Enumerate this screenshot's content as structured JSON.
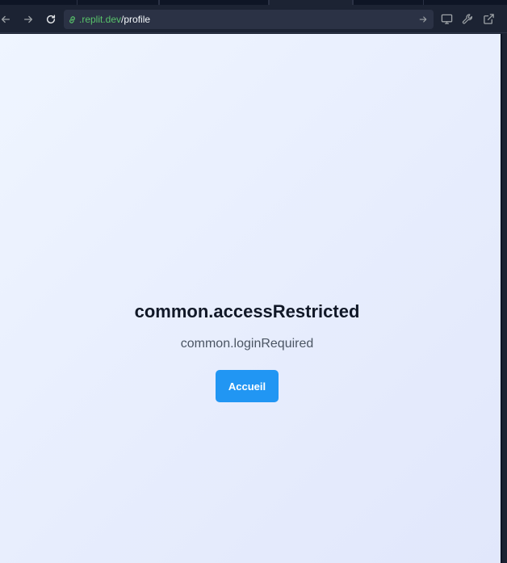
{
  "browser": {
    "url_host": ".replit.dev",
    "url_path": "/profile",
    "nav_icons": [
      "arrow-left-icon",
      "arrow-right-icon",
      "reload-icon"
    ],
    "tool_icons": [
      "monitor-icon",
      "wrench-icon",
      "external-link-icon"
    ]
  },
  "page": {
    "title": "common.accessRestricted",
    "message": "common.loginRequired",
    "home_button_label": "Accueil"
  },
  "colors": {
    "accent_button": "#2196f3",
    "url_host": "#58c26a",
    "toolbar_bg": "#1c2333"
  }
}
